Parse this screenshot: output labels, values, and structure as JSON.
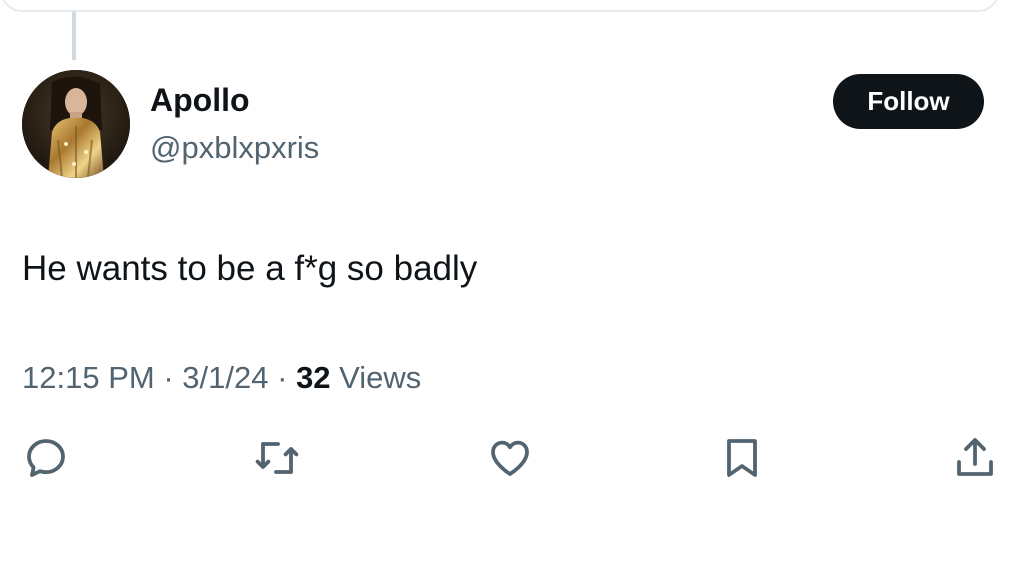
{
  "tweet": {
    "author": {
      "name": "Apollo",
      "handle": "@pxblxpxris",
      "avatar_icon": "profile-photo"
    },
    "follow_label": "Follow",
    "text": "He wants to be a f*g so badly",
    "meta": {
      "time": "12:15 PM",
      "separator": "·",
      "date": "3/1/24",
      "views_count": "32",
      "views_label": "Views"
    },
    "actions": [
      {
        "icon": "reply-icon"
      },
      {
        "icon": "retweet-icon"
      },
      {
        "icon": "like-icon"
      },
      {
        "icon": "bookmark-icon"
      },
      {
        "icon": "share-icon"
      }
    ]
  },
  "colors": {
    "text_primary": "#0f1419",
    "text_secondary": "#536471",
    "button_bg": "#0f1419",
    "button_text": "#ffffff",
    "thread_line": "#cfd9de",
    "background": "#ffffff"
  }
}
